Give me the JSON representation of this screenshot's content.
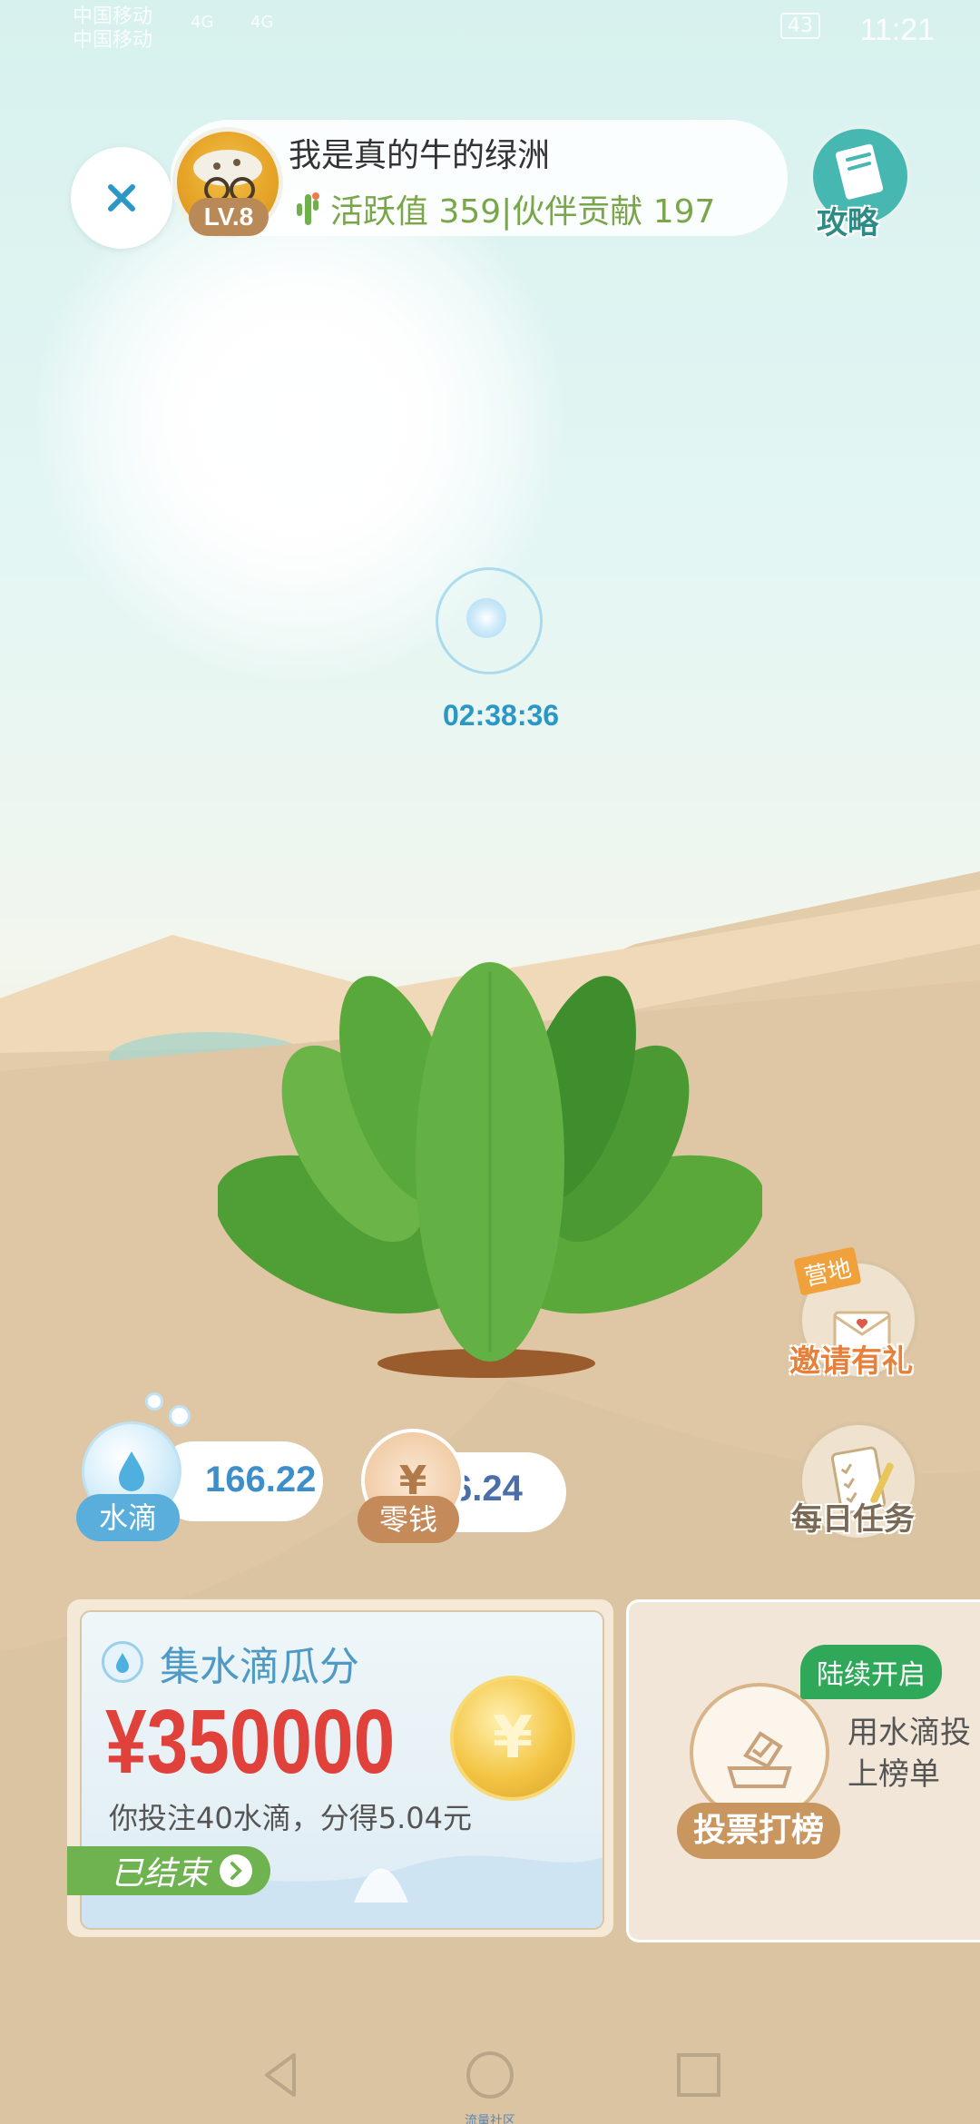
{
  "status_bar": {
    "carrier1": "中国移动",
    "carrier2": "中国移动",
    "net1": "4G",
    "net2": "4G",
    "battery": "43",
    "time": "11:21"
  },
  "header": {
    "profile_name": "我是真的牛的绿洲",
    "level": "LV.8",
    "stats": "活跃值 359|伙伴贡献 197",
    "guide_label": "攻略"
  },
  "timer": {
    "value": "02:38:36"
  },
  "side_actions": {
    "invite_badge": "营地",
    "invite_label": "邀请有礼",
    "daily_label": "每日任务"
  },
  "balances": {
    "water_label": "水滴",
    "water_value": "166.22",
    "cash_symbol": "¥",
    "cash_label": "零钱",
    "cash_value": "6.24"
  },
  "promo_left": {
    "title": "集水滴瓜分",
    "amount": "¥350000",
    "coin_symbol": "¥",
    "desc": "你投注40水滴，分得5.04元",
    "status": "已结束"
  },
  "promo_right": {
    "badge": "陆续开启",
    "action": "投票打榜",
    "desc_line1": "用水滴投",
    "desc_line2": "上榜单"
  },
  "nav": {
    "caption": "流量社区"
  },
  "colors": {
    "accent_blue": "#2b97c7",
    "plant_green": "#5aa83a",
    "cash_brown": "#b98a57",
    "price_red": "#e0413b"
  },
  "icons": [
    "close-icon",
    "cactus-icon",
    "book-icon",
    "envelope-icon",
    "clipboard-icon",
    "water-drop-icon",
    "coin-icon",
    "ballot-box-icon",
    "chevron-right-icon",
    "back-icon",
    "home-icon",
    "recents-icon"
  ]
}
